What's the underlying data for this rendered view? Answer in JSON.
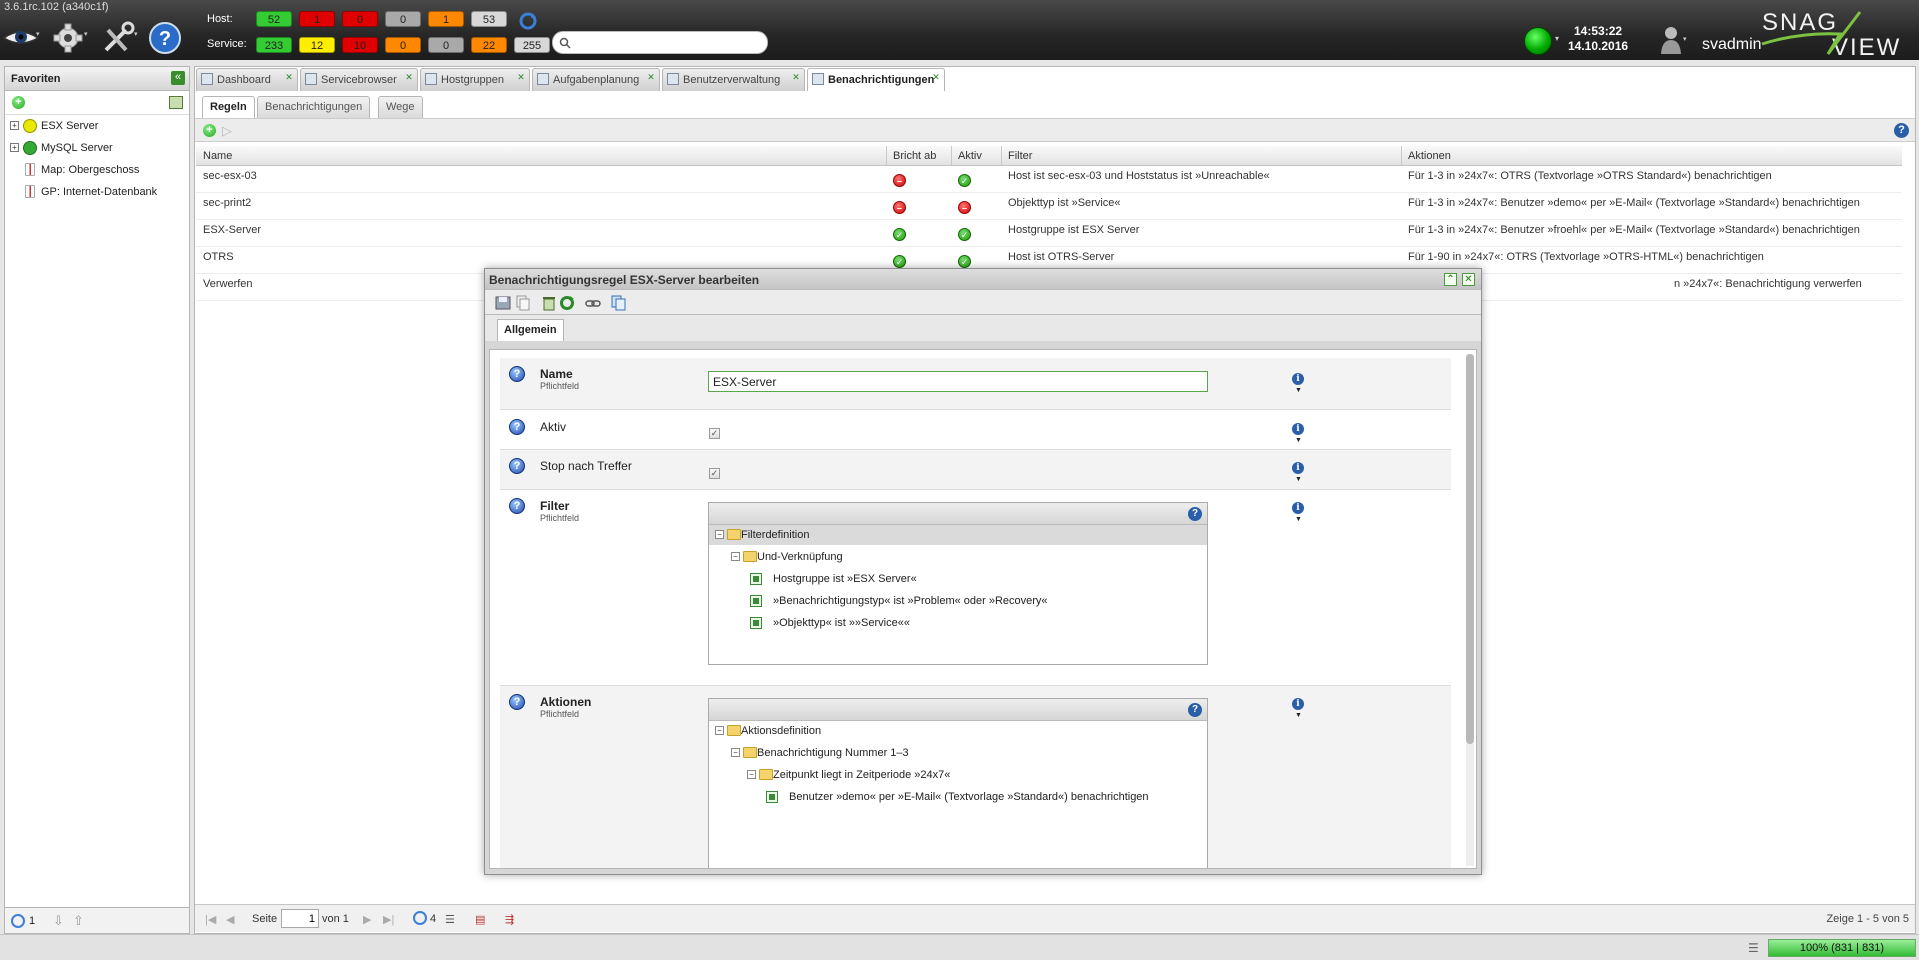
{
  "app": {
    "version": "3.6.1rc.102 (a340c1f)"
  },
  "header": {
    "host_label": "Host:",
    "service_label": "Service:",
    "host_counts": [
      {
        "value": "52",
        "color": "#33cc33"
      },
      {
        "value": "1",
        "color": "#e00000"
      },
      {
        "value": "0",
        "color": "#e00000"
      },
      {
        "value": "0",
        "color": "#a9a9a9"
      },
      {
        "value": "1",
        "color": "#ff8800"
      },
      {
        "value": "53",
        "color": "#d8d8d8"
      }
    ],
    "service_counts": [
      {
        "value": "233",
        "color": "#33cc33"
      },
      {
        "value": "12",
        "color": "#ffee00"
      },
      {
        "value": "10",
        "color": "#e00000"
      },
      {
        "value": "0",
        "color": "#ff8800"
      },
      {
        "value": "0",
        "color": "#a9a9a9"
      },
      {
        "value": "22",
        "color": "#ff8800"
      },
      {
        "value": "255",
        "color": "#d8d8d8"
      }
    ],
    "search": {
      "placeholder": ""
    },
    "time": "14:53:22",
    "date": "14.10.2016",
    "user": "svadmin",
    "logo_text": "SNAG VIEW",
    "icons": [
      "eye-icon",
      "gear-icon",
      "tools-icon",
      "help-icon",
      "refresh-icon",
      "status-online-icon",
      "user-icon"
    ]
  },
  "sidebar": {
    "title": "Favoriten",
    "items": [
      {
        "label": "ESX Server",
        "icon": "yellow-status-icon",
        "color": "#e8e800"
      },
      {
        "label": "MySQL Server",
        "icon": "green-status-icon",
        "color": "#33aa33"
      },
      {
        "label": "Map: Obergeschoss",
        "icon": "map-icon"
      },
      {
        "label": "GP: Internet-Datenbank",
        "icon": "graph-icon"
      }
    ],
    "footer_count": "1"
  },
  "tabs": [
    {
      "label": "Dashboard",
      "icon": "dashboard-icon"
    },
    {
      "label": "Servicebrowser",
      "icon": "servicebrowser-icon"
    },
    {
      "label": "Hostgruppen",
      "icon": "hostgroup-icon"
    },
    {
      "label": "Aufgabenplanung",
      "icon": "calendar-icon"
    },
    {
      "label": "Benutzerverwaltung",
      "icon": "users-icon"
    },
    {
      "label": "Benachrichtigungen",
      "icon": "envelope-icon",
      "active": true
    }
  ],
  "subtabs": [
    {
      "label": "Regeln",
      "active": true
    },
    {
      "label": "Benachrichtigungen"
    },
    {
      "label": "Wege"
    }
  ],
  "grid": {
    "columns": [
      "Name",
      "Bricht ab",
      "Aktiv",
      "Filter",
      "Aktionen"
    ],
    "rows": [
      {
        "name": "sec-esx-03",
        "bricht_ab": "red",
        "aktiv": "green",
        "filter": "Host ist sec-esx-03 und Hoststatus ist »Unreachable«",
        "aktionen": "Für 1-3 in »24x7«: OTRS (Textvorlage »OTRS Standard«) benachrichtigen"
      },
      {
        "name": "sec-print2",
        "bricht_ab": "red",
        "aktiv": "red",
        "filter": "Objekttyp ist »Service«",
        "aktionen": "Für 1-3 in »24x7«: Benutzer »demo« per »E-Mail« (Textvorlage »Standard«) benachrichtigen"
      },
      {
        "name": "ESX-Server",
        "bricht_ab": "green",
        "aktiv": "green",
        "filter": "Hostgruppe ist ESX Server",
        "aktionen": "Für 1-3 in »24x7«: Benutzer »froehl« per »E-Mail« (Textvorlage »Standard«) benachrichtigen"
      },
      {
        "name": "OTRS",
        "bricht_ab": "green",
        "aktiv": "green",
        "filter": "Host ist OTRS-Server",
        "aktionen": "Für 1-90 in »24x7«: OTRS (Textvorlage »OTRS-HTML«) benachrichtigen"
      },
      {
        "name": "Verwerfen",
        "bricht_ab": "",
        "aktiv": "",
        "filter": "",
        "aktionen": "n »24x7«: Benachrichtigung verwerfen"
      }
    ]
  },
  "pager": {
    "page_label": "Seite",
    "page_value": "1",
    "of_label": "von 1",
    "refresh_count": "4",
    "summary": "Zeige 1 - 5 von 5"
  },
  "status": {
    "progress_text": "100% (831 | 831)",
    "progress": 1.0
  },
  "dialog": {
    "title": "Benachrichtigungsregel ESX-Server bearbeiten",
    "tab": "Allgemein",
    "fields": {
      "name": {
        "label": "Name",
        "sub": "Pflichtfeld",
        "value": "ESX-Server"
      },
      "aktiv": {
        "label": "Aktiv",
        "checked": true
      },
      "stop": {
        "label": "Stop nach Treffer",
        "checked": true
      },
      "filter": {
        "label": "Filter",
        "sub": "Pflichtfeld"
      },
      "aktionen": {
        "label": "Aktionen",
        "sub": "Pflichtfeld"
      }
    },
    "filter_tree": [
      {
        "label": "Filterdefinition",
        "level": 0,
        "type": "folder",
        "selected": true
      },
      {
        "label": "Und-Verknüpfung",
        "level": 1,
        "type": "folder"
      },
      {
        "label": "Hostgruppe ist »ESX Server«",
        "level": 2,
        "type": "leaf"
      },
      {
        "label": "»Benachrichtigungstyp« ist »Problem« oder »Recovery«",
        "level": 2,
        "type": "leaf"
      },
      {
        "label": "»Objekttyp« ist »»Service««",
        "level": 2,
        "type": "leaf"
      }
    ],
    "action_tree": [
      {
        "label": "Aktionsdefinition",
        "level": 0,
        "type": "folder"
      },
      {
        "label": "Benachrichtigung Nummer 1–3",
        "level": 1,
        "type": "folder"
      },
      {
        "label": "Zeitpunkt liegt in Zeitperiode »24x7«",
        "level": 2,
        "type": "folder"
      },
      {
        "label": "Benutzer »demo« per »E-Mail« (Textvorlage »Standard«) benachrichtigen",
        "level": 3,
        "type": "leaf"
      }
    ]
  }
}
